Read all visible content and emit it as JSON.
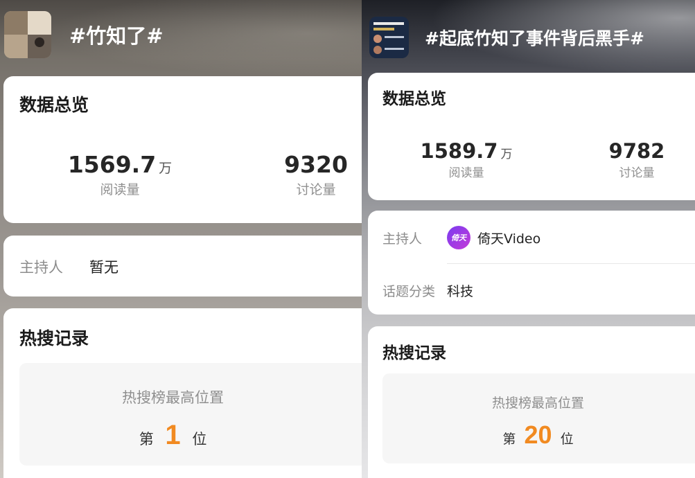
{
  "left": {
    "topic_title": "#竹知了#",
    "overview": {
      "title": "数据总览",
      "read_value": "1569.7",
      "read_unit": "万",
      "read_label": "阅读量",
      "discuss_value": "9320",
      "discuss_label": "讨论量"
    },
    "host": {
      "label": "主持人",
      "value": "暂无"
    },
    "hot": {
      "title": "热搜记录",
      "rank_title": "热搜榜最高位置",
      "prefix": "第",
      "rank": "1",
      "suffix": "位"
    }
  },
  "right": {
    "topic_title": "#起底竹知了事件背后黑手#",
    "overview": {
      "title": "数据总览",
      "read_value": "1589.7",
      "read_unit": "万",
      "read_label": "阅读量",
      "discuss_value": "9782",
      "discuss_label": "讨论量"
    },
    "host": {
      "label": "主持人",
      "value": "倚天Video",
      "logo_text": "倚天"
    },
    "category": {
      "label": "话题分类",
      "value": "科技"
    },
    "hot": {
      "title": "热搜记录",
      "rank_title": "热搜榜最高位置",
      "prefix": "第",
      "rank": "20",
      "suffix": "位"
    }
  },
  "colors": {
    "rank_accent": "#f18a21",
    "host_logo": "#8b3be0"
  }
}
